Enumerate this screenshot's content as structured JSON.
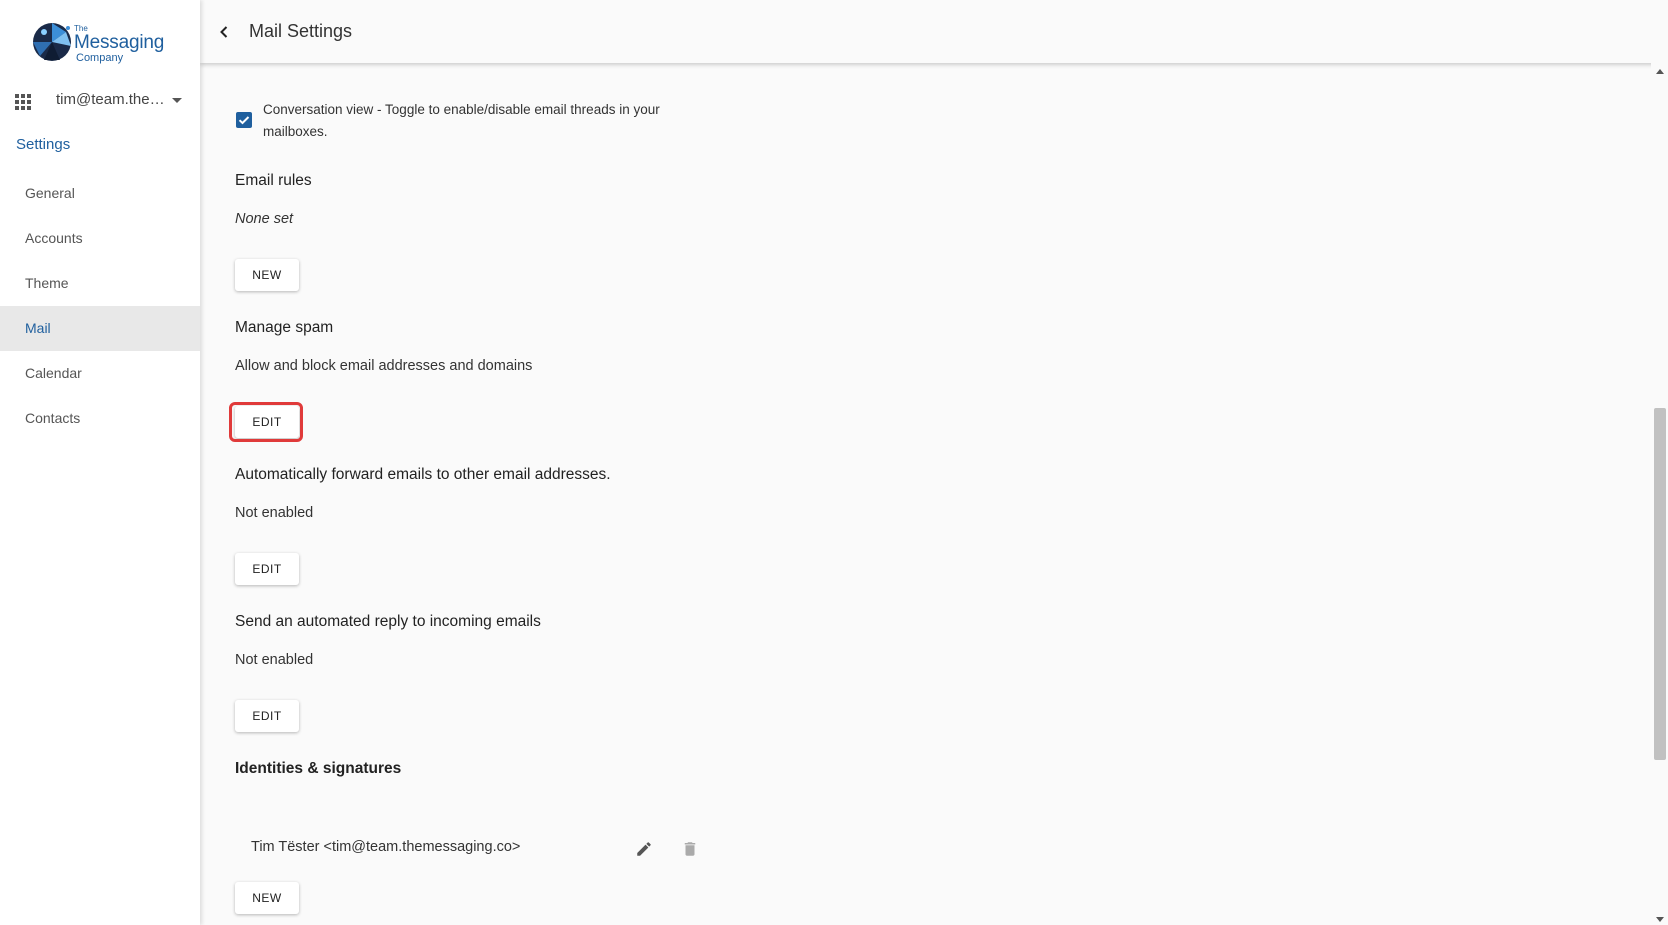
{
  "logo": {
    "line1": "The",
    "line2": "Messaging",
    "line3": "Company"
  },
  "account": {
    "email": "tim@team.the…"
  },
  "sidebar": {
    "heading": "Settings",
    "items": [
      {
        "label": "General"
      },
      {
        "label": "Accounts"
      },
      {
        "label": "Theme"
      },
      {
        "label": "Mail",
        "active": true
      },
      {
        "label": "Calendar"
      },
      {
        "label": "Contacts"
      }
    ]
  },
  "header": {
    "title": "Mail Settings"
  },
  "conversation": {
    "label": "Conversation view - Toggle to enable/disable email threads in your mailboxes.",
    "checked": true
  },
  "sections": {
    "email_rules": {
      "title": "Email rules",
      "desc": "None set",
      "button": "NEW"
    },
    "spam": {
      "title": "Manage spam",
      "desc": "Allow and block email addresses and domains",
      "button": "EDIT"
    },
    "forward": {
      "title": "Automatically forward emails to other email addresses.",
      "desc": "Not enabled",
      "button": "EDIT"
    },
    "autoreply": {
      "title": "Send an automated reply to incoming emails",
      "desc": "Not enabled",
      "button": "EDIT"
    },
    "identities": {
      "title": "Identities & signatures",
      "identity": "Tim Tëster <tim@team.themessaging.co>",
      "button": "NEW"
    }
  },
  "colors": {
    "accent": "#1f5f9e",
    "highlight": "#e03a3a"
  }
}
